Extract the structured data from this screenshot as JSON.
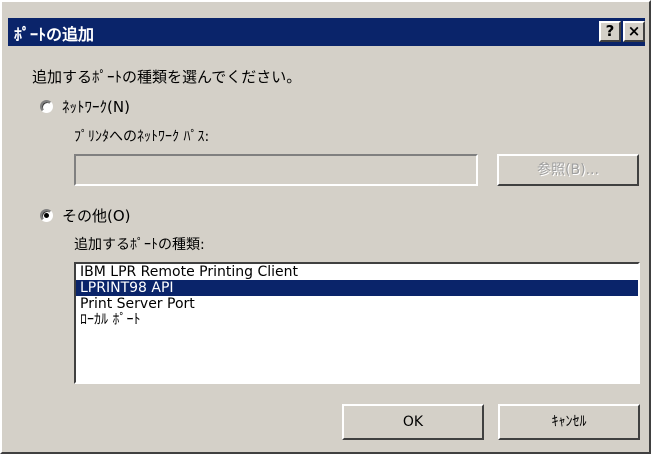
{
  "window": {
    "title": "ﾎﾟｰﾄの追加",
    "help_glyph": "?",
    "close_glyph": "×"
  },
  "instruction": "追加するﾎﾟｰﾄの種類を選んでください。",
  "network_option": {
    "label": "ﾈｯﾄﾜｰｸ(N)",
    "checked": false,
    "path_label": "ﾌﾟﾘﾝﾀへのﾈｯﾄﾜｰｸ ﾊﾟｽ:",
    "path_value": "",
    "browse_label": "参照(B)..."
  },
  "other_option": {
    "label": "その他(O)",
    "checked": true,
    "type_label": "追加するﾎﾟｰﾄの種類:"
  },
  "port_types": [
    {
      "label": "IBM LPR Remote Printing Client",
      "selected": false
    },
    {
      "label": "LPRINT98 API",
      "selected": true
    },
    {
      "label": "Print Server Port",
      "selected": false
    },
    {
      "label": "ﾛｰｶﾙ ﾎﾟｰﾄ",
      "selected": false
    }
  ],
  "buttons": {
    "ok_label": "OK",
    "cancel_label": "ｷｬﾝｾﾙ"
  },
  "colors": {
    "face": "#d4d0c8",
    "title_bar": "#0a246a",
    "selection": "#0a246a"
  }
}
